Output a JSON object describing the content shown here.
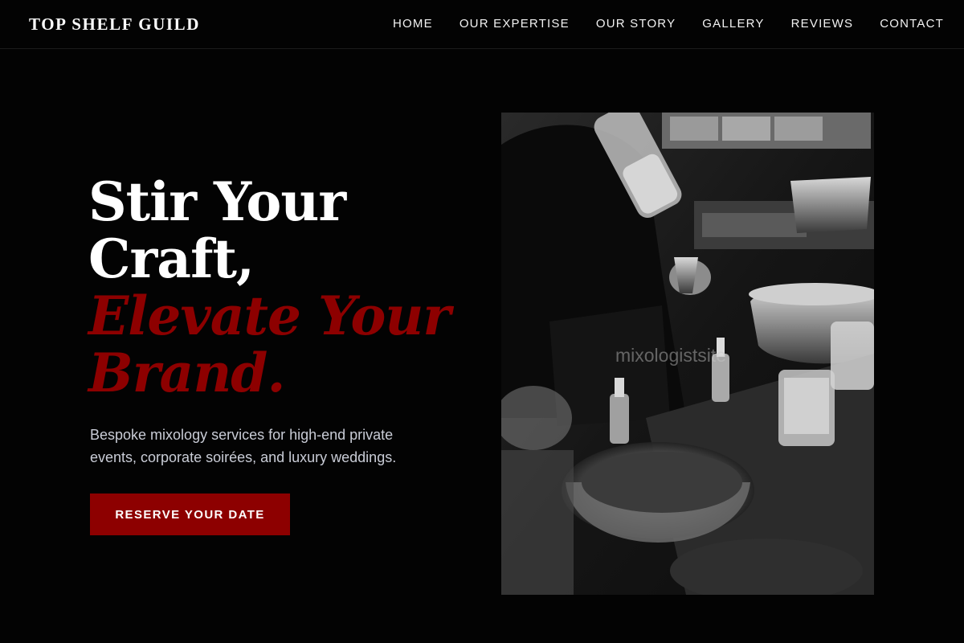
{
  "brand": {
    "name": "TOP SHELF GUILD"
  },
  "nav": {
    "items": [
      {
        "label": "HOME"
      },
      {
        "label": "OUR EXPERTISE"
      },
      {
        "label": "OUR STORY"
      },
      {
        "label": "GALLERY"
      },
      {
        "label": "REVIEWS"
      },
      {
        "label": "CONTACT"
      }
    ]
  },
  "hero": {
    "headline_line1": "Stir Your",
    "headline_line2": "Craft,",
    "headline_line3": "Elevate Your",
    "headline_line4": "Brand.",
    "subtext": "Bespoke mixology services for high-end private events, corporate soirées, and luxury weddings.",
    "cta_label": "RESERVE YOUR DATE",
    "image_watermark": "mixologistsite",
    "image_alt": "Bartender pouring a cocktail behind a bar with ice buckets and glasses"
  },
  "colors": {
    "background": "#030303",
    "accent": "#8d0000",
    "text": "#ffffff",
    "muted_text": "#c9ccd6"
  }
}
